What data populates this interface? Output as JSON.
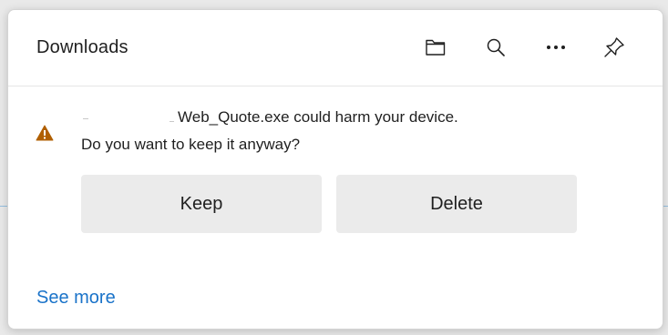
{
  "panel": {
    "title": "Downloads"
  },
  "header_icons": [
    {
      "name": "folder-icon"
    },
    {
      "name": "search-icon"
    },
    {
      "name": "more-options-icon"
    },
    {
      "name": "pin-icon"
    }
  ],
  "warning": {
    "icon": "warning-triangle-icon",
    "icon_color": "#b05f00",
    "line1_suffix": "Web_Quote.exe could harm your device.",
    "line2": "Do you want to keep it anyway?"
  },
  "actions": {
    "keep_label": "Keep",
    "delete_label": "Delete"
  },
  "footer": {
    "see_more_label": "See more",
    "link_color": "#1a73c9"
  }
}
